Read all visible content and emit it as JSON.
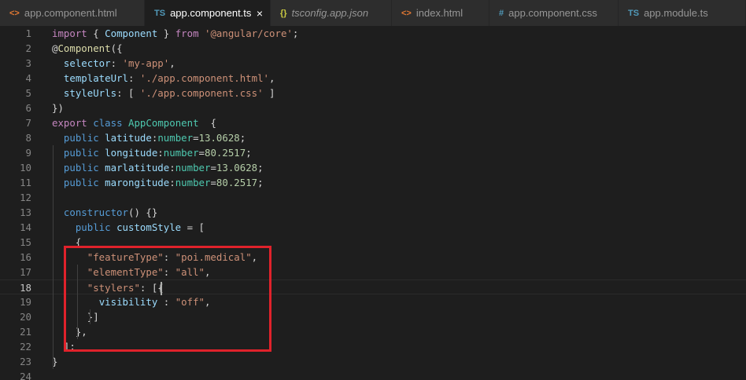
{
  "colors": {
    "keyword": "#c586c0",
    "storage": "#569cd6",
    "variable": "#9cdcfe",
    "class": "#4ec9b0",
    "function": "#dcdcaa",
    "string": "#ce9178",
    "number": "#b5cea8",
    "plain": "#d4d4d4",
    "annotation_box": "#e0222b"
  },
  "tabs": [
    {
      "icon": "<>",
      "icon_name": "html-file-icon",
      "icon_color": "#e37933",
      "label": "app.component.html",
      "active": false,
      "italic": false,
      "width": 184
    },
    {
      "icon": "TS",
      "icon_name": "typescript-file-icon",
      "icon_color": "#519aba",
      "label": "app.component.ts",
      "active": true,
      "italic": false,
      "close": "×",
      "width": 160
    },
    {
      "icon": "{}",
      "icon_name": "json-file-icon",
      "icon_color": "#cbcb41",
      "label": "tsconfig.app.json",
      "active": false,
      "italic": true,
      "width": 154
    },
    {
      "icon": "<>",
      "icon_name": "html-file-icon",
      "icon_color": "#e37933",
      "label": "index.html",
      "active": false,
      "italic": false,
      "width": 124
    },
    {
      "icon": "#",
      "icon_name": "css-file-icon",
      "icon_color": "#519aba",
      "label": "app.component.css",
      "active": false,
      "italic": false,
      "width": 164
    },
    {
      "icon": "TS",
      "icon_name": "typescript-file-icon",
      "icon_color": "#519aba",
      "label": "app.module.ts",
      "active": false,
      "italic": false,
      "width": 162
    }
  ],
  "editor": {
    "current_line": 18,
    "lines": [
      {
        "n": "1",
        "t": [
          [
            "keyword",
            "import"
          ],
          [
            "plain",
            " { "
          ],
          [
            "variable",
            "Component"
          ],
          [
            "plain",
            " } "
          ],
          [
            "keyword",
            "from"
          ],
          [
            "plain",
            " "
          ],
          [
            "string",
            "'@angular/core'"
          ],
          [
            "plain",
            ";"
          ]
        ]
      },
      {
        "n": "2",
        "t": [
          [
            "plain",
            "@"
          ],
          [
            "function",
            "Component"
          ],
          [
            "plain",
            "({"
          ]
        ]
      },
      {
        "n": "3",
        "t": [
          [
            "plain",
            "  "
          ],
          [
            "variable",
            "selector"
          ],
          [
            "plain",
            ": "
          ],
          [
            "string",
            "'my-app'"
          ],
          [
            "plain",
            ","
          ]
        ]
      },
      {
        "n": "4",
        "t": [
          [
            "plain",
            "  "
          ],
          [
            "variable",
            "templateUrl"
          ],
          [
            "plain",
            ": "
          ],
          [
            "string",
            "'./app.component.html'"
          ],
          [
            "plain",
            ","
          ]
        ]
      },
      {
        "n": "5",
        "t": [
          [
            "plain",
            "  "
          ],
          [
            "variable",
            "styleUrls"
          ],
          [
            "plain",
            ": [ "
          ],
          [
            "string",
            "'./app.component.css'"
          ],
          [
            "plain",
            " ]"
          ]
        ]
      },
      {
        "n": "6",
        "t": [
          [
            "plain",
            "})"
          ]
        ]
      },
      {
        "n": "7",
        "t": [
          [
            "keyword",
            "export"
          ],
          [
            "plain",
            " "
          ],
          [
            "storage",
            "class"
          ],
          [
            "plain",
            " "
          ],
          [
            "class",
            "AppComponent"
          ],
          [
            "plain",
            "  {"
          ]
        ]
      },
      {
        "n": "8",
        "t": [
          [
            "plain",
            "  "
          ],
          [
            "storage",
            "public"
          ],
          [
            "plain",
            " "
          ],
          [
            "variable",
            "latitude"
          ],
          [
            "plain",
            ":"
          ],
          [
            "class",
            "number"
          ],
          [
            "plain",
            "="
          ],
          [
            "number",
            "13.0628"
          ],
          [
            "plain",
            ";"
          ]
        ]
      },
      {
        "n": "9",
        "t": [
          [
            "plain",
            "  "
          ],
          [
            "storage",
            "public"
          ],
          [
            "plain",
            " "
          ],
          [
            "variable",
            "longitude"
          ],
          [
            "plain",
            ":"
          ],
          [
            "class",
            "number"
          ],
          [
            "plain",
            "="
          ],
          [
            "number",
            "80.2517"
          ],
          [
            "plain",
            ";"
          ]
        ]
      },
      {
        "n": "10",
        "t": [
          [
            "plain",
            "  "
          ],
          [
            "storage",
            "public"
          ],
          [
            "plain",
            " "
          ],
          [
            "variable",
            "marlatitude"
          ],
          [
            "plain",
            ":"
          ],
          [
            "class",
            "number"
          ],
          [
            "plain",
            "="
          ],
          [
            "number",
            "13.0628"
          ],
          [
            "plain",
            ";"
          ]
        ]
      },
      {
        "n": "11",
        "t": [
          [
            "plain",
            "  "
          ],
          [
            "storage",
            "public"
          ],
          [
            "plain",
            " "
          ],
          [
            "variable",
            "marongitude"
          ],
          [
            "plain",
            ":"
          ],
          [
            "class",
            "number"
          ],
          [
            "plain",
            "="
          ],
          [
            "number",
            "80.2517"
          ],
          [
            "plain",
            ";"
          ]
        ]
      },
      {
        "n": "12",
        "t": []
      },
      {
        "n": "13",
        "t": [
          [
            "plain",
            "  "
          ],
          [
            "storage",
            "constructor"
          ],
          [
            "plain",
            "() {}"
          ]
        ]
      },
      {
        "n": "14",
        "t": [
          [
            "plain",
            "    "
          ],
          [
            "storage",
            "public"
          ],
          [
            "plain",
            " "
          ],
          [
            "variable",
            "customStyle"
          ],
          [
            "plain",
            " = ["
          ]
        ]
      },
      {
        "n": "15",
        "t": [
          [
            "plain",
            "    {"
          ]
        ]
      },
      {
        "n": "16",
        "t": [
          [
            "plain",
            "      "
          ],
          [
            "string",
            "\"featureType\""
          ],
          [
            "plain",
            ": "
          ],
          [
            "string",
            "\"poi.medical\""
          ],
          [
            "plain",
            ","
          ]
        ]
      },
      {
        "n": "17",
        "t": [
          [
            "plain",
            "      "
          ],
          [
            "string",
            "\"elementType\""
          ],
          [
            "plain",
            ": "
          ],
          [
            "string",
            "\"all\""
          ],
          [
            "plain",
            ","
          ]
        ]
      },
      {
        "n": "18",
        "t": [
          [
            "plain",
            "      "
          ],
          [
            "string",
            "\"stylers\""
          ],
          [
            "plain",
            ": ["
          ],
          [
            "plain",
            "{"
          ]
        ]
      },
      {
        "n": "19",
        "t": [
          [
            "plain",
            "        "
          ],
          [
            "variable",
            "visibility"
          ],
          [
            "plain",
            " : "
          ],
          [
            "string",
            "\"off\""
          ],
          [
            "plain",
            ","
          ]
        ]
      },
      {
        "n": "20",
        "t": [
          [
            "plain",
            "      }]"
          ]
        ]
      },
      {
        "n": "21",
        "t": [
          [
            "plain",
            "    },"
          ]
        ]
      },
      {
        "n": "22",
        "t": [
          [
            "plain",
            "  ];"
          ]
        ]
      },
      {
        "n": "23",
        "t": [
          [
            "plain",
            "}"
          ]
        ]
      },
      {
        "n": "24",
        "t": []
      }
    ]
  }
}
